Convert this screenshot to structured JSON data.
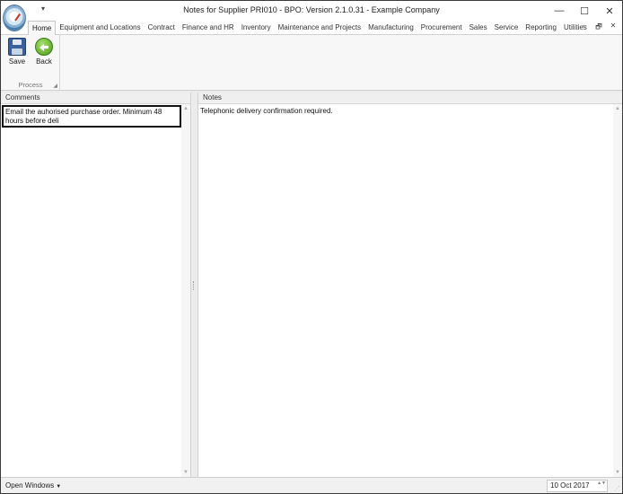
{
  "window": {
    "title": "Notes for Supplier PRI010 - BPO: Version 2.1.0.31 - Example Company",
    "controls": {
      "minimize": "—",
      "maximize": "☐",
      "close": "✕"
    }
  },
  "qat": {
    "arrow": "▾"
  },
  "ribbon": {
    "tabs": [
      {
        "label": "Home",
        "active": true
      },
      {
        "label": "Equipment and Locations"
      },
      {
        "label": "Contract"
      },
      {
        "label": "Finance and HR"
      },
      {
        "label": "Inventory"
      },
      {
        "label": "Maintenance and Projects"
      },
      {
        "label": "Manufacturing"
      },
      {
        "label": "Procurement"
      },
      {
        "label": "Sales"
      },
      {
        "label": "Service"
      },
      {
        "label": "Reporting"
      },
      {
        "label": "Utilities"
      }
    ],
    "tab_controls": {
      "minimize": "–",
      "restore": "🗗",
      "close": "✕"
    },
    "group": {
      "label": "Process",
      "launcher": "◢",
      "buttons": {
        "save": "Save",
        "back": "Back"
      }
    }
  },
  "panels": {
    "comments": {
      "header": "Comments",
      "text": "Email the auhorised purchase order.  Minimum 48 hours before deli"
    },
    "notes": {
      "header": "Notes",
      "text": "Telephonic delivery confirmation required."
    },
    "scroll": {
      "up": "▲",
      "down": "▼"
    }
  },
  "statusbar": {
    "open_windows": "Open Windows",
    "open_windows_caret": "▼",
    "date": "10 Oct 2017",
    "spin": "▲▼",
    "grip": "⋰"
  }
}
